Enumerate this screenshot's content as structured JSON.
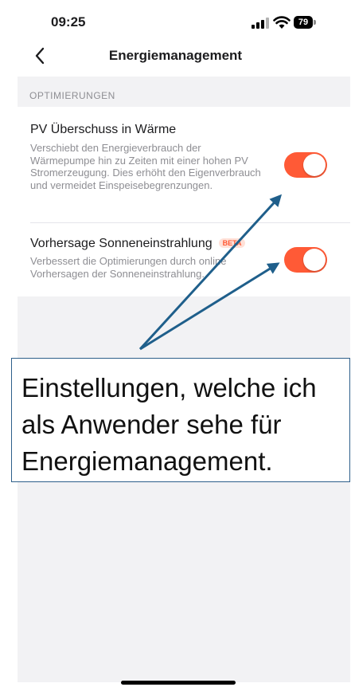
{
  "status_bar": {
    "time": "09:25",
    "battery": "79",
    "icons": [
      "cellular-signal-icon",
      "wifi-icon",
      "battery-icon"
    ]
  },
  "nav": {
    "back_icon": "chevron-left-icon",
    "title": "Energiemanagement"
  },
  "section": {
    "header": "OPTIMIERUNGEN",
    "items": [
      {
        "title": "PV Überschuss in Wärme",
        "description": "Verschiebt den Energieverbrauch der Wärmepumpe hin zu Zeiten mit einer hohen PV Stromerzeugung. Dies erhöht den Eigenverbrauch und vermeidet Einspeisebegrenzungen.",
        "enabled": true
      },
      {
        "title": "Vorhersage Sonneneinstrahlung",
        "badge": "BETA",
        "description": "Verbessert die Optimierungen durch online Vorhersagen der Sonneneinstrahlung.",
        "enabled": true
      }
    ]
  },
  "annotation": {
    "text": "Einstellungen, welche ich als Anwender sehe für Energiemanagement."
  },
  "colors": {
    "toggle_on": "#ff5a36",
    "arrow": "#1f5f8b",
    "background": "#f2f2f4",
    "secondary_text": "#8e8e93"
  }
}
